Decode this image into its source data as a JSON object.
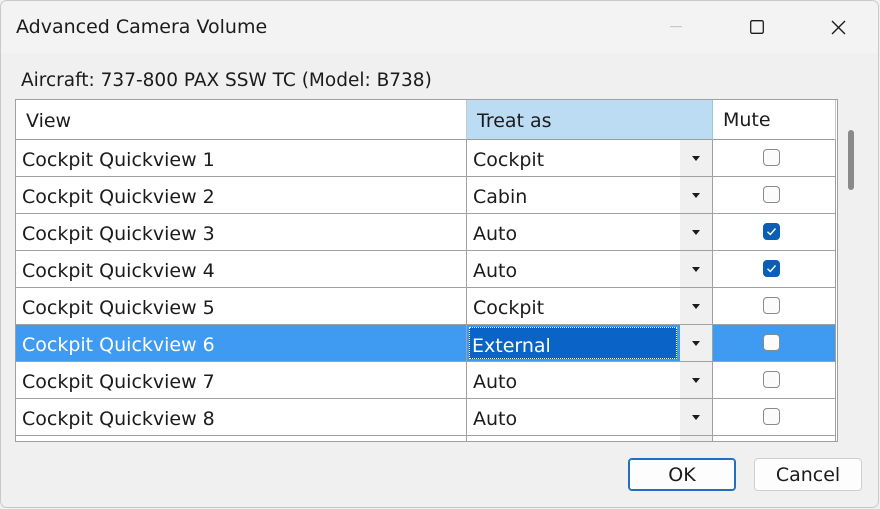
{
  "window": {
    "title": "Advanced Camera Volume",
    "controls": {
      "minimize_icon": "minimize-icon",
      "maximize_icon": "maximize-icon",
      "close_icon": "close-icon"
    }
  },
  "aircraft_label": "Aircraft: 737-800 PAX SSW TC  (Model: B738)",
  "grid": {
    "columns": {
      "view": "View",
      "treat_as": "Treat as",
      "mute": "Mute"
    },
    "rows": [
      {
        "view": "Cockpit Quickview 1",
        "treat_as": "Cockpit",
        "mute": false,
        "selected": false
      },
      {
        "view": "Cockpit Quickview 2",
        "treat_as": "Cabin",
        "mute": false,
        "selected": false
      },
      {
        "view": "Cockpit Quickview 3",
        "treat_as": "Auto",
        "mute": true,
        "selected": false
      },
      {
        "view": "Cockpit Quickview 4",
        "treat_as": "Auto",
        "mute": true,
        "selected": false
      },
      {
        "view": "Cockpit Quickview 5",
        "treat_as": "Cockpit",
        "mute": false,
        "selected": false
      },
      {
        "view": "Cockpit Quickview 6",
        "treat_as": "External",
        "mute": false,
        "selected": true
      },
      {
        "view": "Cockpit Quickview 7",
        "treat_as": "Auto",
        "mute": false,
        "selected": false
      },
      {
        "view": "Cockpit Quickview 8",
        "treat_as": "Auto",
        "mute": false,
        "selected": false
      },
      {
        "view": "",
        "treat_as": "",
        "mute": false,
        "selected": false
      }
    ]
  },
  "buttons": {
    "ok": "OK",
    "cancel": "Cancel"
  },
  "colors": {
    "header_selected": "#bcdcf4",
    "row_selected": "#3f9af2",
    "checkbox_checked": "#0a5fb4",
    "ok_border": "#1f6fc2"
  }
}
